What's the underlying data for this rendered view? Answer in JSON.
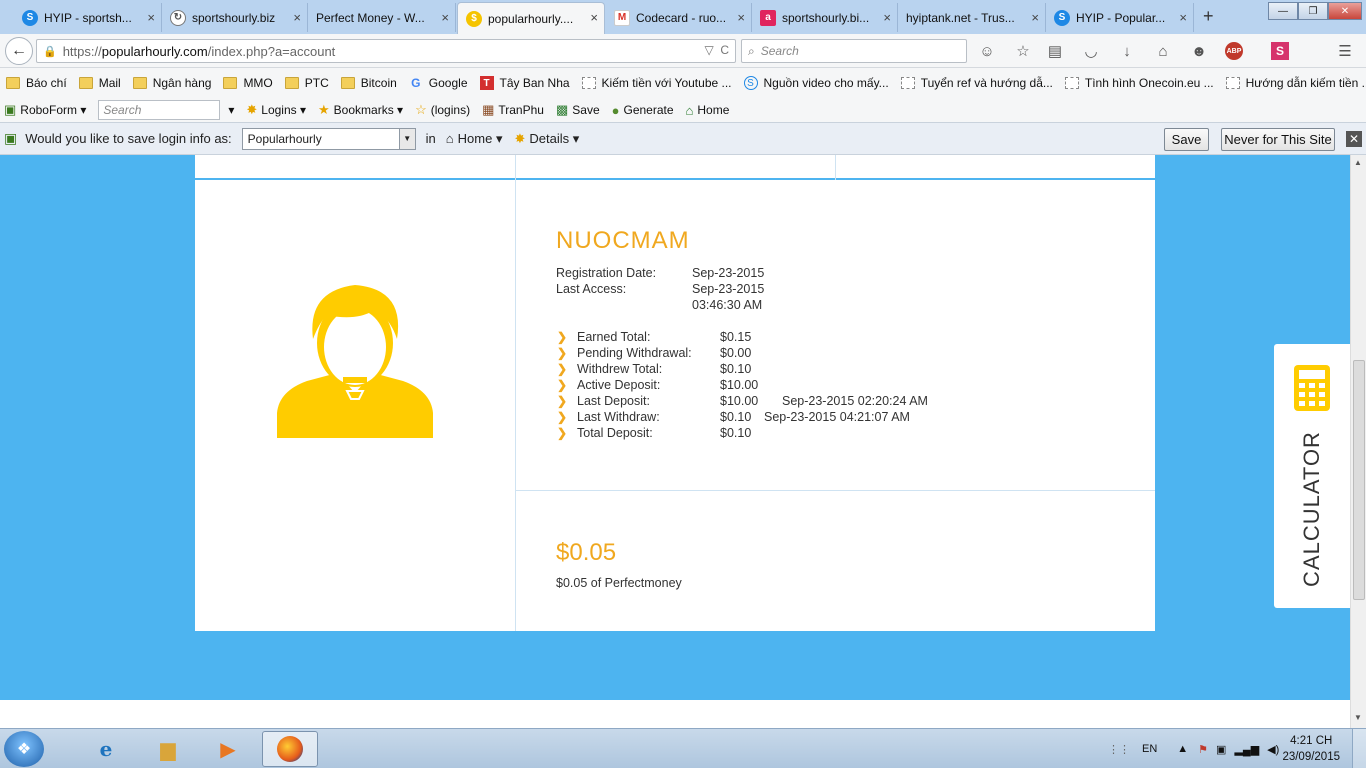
{
  "browser": {
    "tabs": [
      {
        "label": "HYIP - sportsh...",
        "icon": "s-icon",
        "color": "#1e88e5",
        "active": false
      },
      {
        "label": "sportshourly.biz",
        "icon": "loading-icon",
        "color": "#555555",
        "active": false
      },
      {
        "label": "Perfect Money - W...",
        "icon": "",
        "color": "",
        "active": false
      },
      {
        "label": "popularhourly....",
        "icon": "dollar-coin-icon",
        "color": "#f5c400",
        "active": true
      },
      {
        "label": "Codecard - ruo...",
        "icon": "gmail-icon",
        "color": "#d93025",
        "active": false
      },
      {
        "label": "sportshourly.bi...",
        "icon": "a-icon",
        "color": "#e0245e",
        "active": false
      },
      {
        "label": "hyiptank.net - Trus...",
        "icon": "",
        "color": "",
        "active": false
      },
      {
        "label": "HYIP - Popular...",
        "icon": "s-icon",
        "color": "#1e88e5",
        "active": false
      }
    ],
    "url_scheme": "https://",
    "url_host": "popularhourly.com",
    "url_path": "/index.php?a=account",
    "search_placeholder": "Search",
    "bookmarks": [
      {
        "label": "Báo chí",
        "icon": "folder-icon"
      },
      {
        "label": "Mail",
        "icon": "folder-icon"
      },
      {
        "label": "Ngân hàng",
        "icon": "folder-icon"
      },
      {
        "label": "MMO",
        "icon": "folder-icon"
      },
      {
        "label": "PTC",
        "icon": "folder-icon"
      },
      {
        "label": "Bitcoin",
        "icon": "folder-icon"
      },
      {
        "label": "Google",
        "icon": "google-icon"
      },
      {
        "label": "Tây Ban Nha",
        "icon": "t-icon"
      },
      {
        "label": "Kiếm tiền với Youtube ...",
        "icon": "page-icon"
      },
      {
        "label": "Nguồn video cho mấy...",
        "icon": "s-icon"
      },
      {
        "label": "Tuyển ref và hướng dẫ...",
        "icon": "page-icon"
      },
      {
        "label": "Tình hình Onecoin.eu ...",
        "icon": "page-icon"
      },
      {
        "label": "Hướng dẫn kiếm tiền ...",
        "icon": "page-icon"
      }
    ]
  },
  "roboform": {
    "brand": "RoboForm",
    "search_placeholder": "Search",
    "items": [
      "Logins",
      "Bookmarks",
      "(logins)",
      "TranPhu",
      "Save",
      "Generate",
      "Home"
    ]
  },
  "savebar": {
    "prompt": "Would you like to save login info as:",
    "login_name": "Popularhourly",
    "in_label": "in",
    "folder": "Home",
    "details": "Details",
    "save_button": "Save",
    "never_button": "Never for This Site"
  },
  "account": {
    "username": "NUOCMAM",
    "registration_label": "Registration Date:",
    "registration_value": "Sep-23-2015",
    "last_access_label": "Last Access:",
    "last_access_date": "Sep-23-2015",
    "last_access_time": "03:46:30 AM",
    "stats": [
      {
        "label": "Earned Total:",
        "value": "$0.15",
        "extra": ""
      },
      {
        "label": "Pending Withdrawal:",
        "value": "$0.00",
        "extra": ""
      },
      {
        "label": "Withdrew Total:",
        "value": "$0.10",
        "extra": ""
      },
      {
        "label": "Active Deposit:",
        "value": "$10.00",
        "extra": ""
      },
      {
        "label": "Last Deposit:",
        "value": "$10.00",
        "extra": "Sep-23-2015 02:20:24 AM"
      },
      {
        "label": "Last Withdraw:",
        "value": "$0.10",
        "extra": "Sep-23-2015 04:21:07 AM"
      },
      {
        "label": "Total Deposit:",
        "value": "$0.10",
        "extra": ""
      }
    ],
    "balance": "$0.05",
    "balance_note": "$0.05 of Perfectmoney"
  },
  "calculator_label": "CALCULATOR",
  "taskbar": {
    "language": "EN",
    "time": "4:21 CH",
    "date": "23/09/2015"
  },
  "colors": {
    "accent_orange": "#f0a81f",
    "page_blue": "#4db4f0",
    "avatar_yellow": "#ffcc00"
  }
}
